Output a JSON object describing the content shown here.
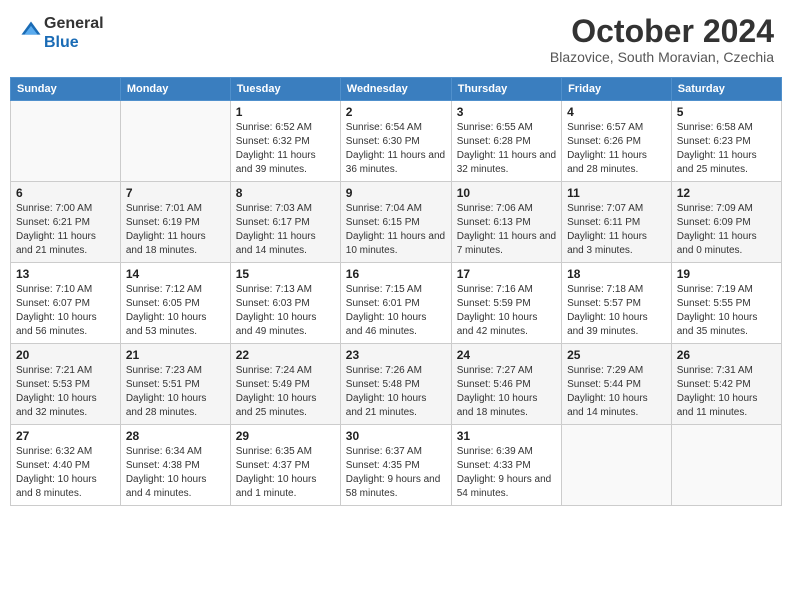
{
  "header": {
    "logo_line1": "General",
    "logo_line2": "Blue",
    "month": "October 2024",
    "location": "Blazovice, South Moravian, Czechia"
  },
  "weekdays": [
    "Sunday",
    "Monday",
    "Tuesday",
    "Wednesday",
    "Thursday",
    "Friday",
    "Saturday"
  ],
  "weeks": [
    [
      {
        "day": "",
        "sunrise": "",
        "sunset": "",
        "daylight": ""
      },
      {
        "day": "",
        "sunrise": "",
        "sunset": "",
        "daylight": ""
      },
      {
        "day": "1",
        "sunrise": "Sunrise: 6:52 AM",
        "sunset": "Sunset: 6:32 PM",
        "daylight": "Daylight: 11 hours and 39 minutes."
      },
      {
        "day": "2",
        "sunrise": "Sunrise: 6:54 AM",
        "sunset": "Sunset: 6:30 PM",
        "daylight": "Daylight: 11 hours and 36 minutes."
      },
      {
        "day": "3",
        "sunrise": "Sunrise: 6:55 AM",
        "sunset": "Sunset: 6:28 PM",
        "daylight": "Daylight: 11 hours and 32 minutes."
      },
      {
        "day": "4",
        "sunrise": "Sunrise: 6:57 AM",
        "sunset": "Sunset: 6:26 PM",
        "daylight": "Daylight: 11 hours and 28 minutes."
      },
      {
        "day": "5",
        "sunrise": "Sunrise: 6:58 AM",
        "sunset": "Sunset: 6:23 PM",
        "daylight": "Daylight: 11 hours and 25 minutes."
      }
    ],
    [
      {
        "day": "6",
        "sunrise": "Sunrise: 7:00 AM",
        "sunset": "Sunset: 6:21 PM",
        "daylight": "Daylight: 11 hours and 21 minutes."
      },
      {
        "day": "7",
        "sunrise": "Sunrise: 7:01 AM",
        "sunset": "Sunset: 6:19 PM",
        "daylight": "Daylight: 11 hours and 18 minutes."
      },
      {
        "day": "8",
        "sunrise": "Sunrise: 7:03 AM",
        "sunset": "Sunset: 6:17 PM",
        "daylight": "Daylight: 11 hours and 14 minutes."
      },
      {
        "day": "9",
        "sunrise": "Sunrise: 7:04 AM",
        "sunset": "Sunset: 6:15 PM",
        "daylight": "Daylight: 11 hours and 10 minutes."
      },
      {
        "day": "10",
        "sunrise": "Sunrise: 7:06 AM",
        "sunset": "Sunset: 6:13 PM",
        "daylight": "Daylight: 11 hours and 7 minutes."
      },
      {
        "day": "11",
        "sunrise": "Sunrise: 7:07 AM",
        "sunset": "Sunset: 6:11 PM",
        "daylight": "Daylight: 11 hours and 3 minutes."
      },
      {
        "day": "12",
        "sunrise": "Sunrise: 7:09 AM",
        "sunset": "Sunset: 6:09 PM",
        "daylight": "Daylight: 11 hours and 0 minutes."
      }
    ],
    [
      {
        "day": "13",
        "sunrise": "Sunrise: 7:10 AM",
        "sunset": "Sunset: 6:07 PM",
        "daylight": "Daylight: 10 hours and 56 minutes."
      },
      {
        "day": "14",
        "sunrise": "Sunrise: 7:12 AM",
        "sunset": "Sunset: 6:05 PM",
        "daylight": "Daylight: 10 hours and 53 minutes."
      },
      {
        "day": "15",
        "sunrise": "Sunrise: 7:13 AM",
        "sunset": "Sunset: 6:03 PM",
        "daylight": "Daylight: 10 hours and 49 minutes."
      },
      {
        "day": "16",
        "sunrise": "Sunrise: 7:15 AM",
        "sunset": "Sunset: 6:01 PM",
        "daylight": "Daylight: 10 hours and 46 minutes."
      },
      {
        "day": "17",
        "sunrise": "Sunrise: 7:16 AM",
        "sunset": "Sunset: 5:59 PM",
        "daylight": "Daylight: 10 hours and 42 minutes."
      },
      {
        "day": "18",
        "sunrise": "Sunrise: 7:18 AM",
        "sunset": "Sunset: 5:57 PM",
        "daylight": "Daylight: 10 hours and 39 minutes."
      },
      {
        "day": "19",
        "sunrise": "Sunrise: 7:19 AM",
        "sunset": "Sunset: 5:55 PM",
        "daylight": "Daylight: 10 hours and 35 minutes."
      }
    ],
    [
      {
        "day": "20",
        "sunrise": "Sunrise: 7:21 AM",
        "sunset": "Sunset: 5:53 PM",
        "daylight": "Daylight: 10 hours and 32 minutes."
      },
      {
        "day": "21",
        "sunrise": "Sunrise: 7:23 AM",
        "sunset": "Sunset: 5:51 PM",
        "daylight": "Daylight: 10 hours and 28 minutes."
      },
      {
        "day": "22",
        "sunrise": "Sunrise: 7:24 AM",
        "sunset": "Sunset: 5:49 PM",
        "daylight": "Daylight: 10 hours and 25 minutes."
      },
      {
        "day": "23",
        "sunrise": "Sunrise: 7:26 AM",
        "sunset": "Sunset: 5:48 PM",
        "daylight": "Daylight: 10 hours and 21 minutes."
      },
      {
        "day": "24",
        "sunrise": "Sunrise: 7:27 AM",
        "sunset": "Sunset: 5:46 PM",
        "daylight": "Daylight: 10 hours and 18 minutes."
      },
      {
        "day": "25",
        "sunrise": "Sunrise: 7:29 AM",
        "sunset": "Sunset: 5:44 PM",
        "daylight": "Daylight: 10 hours and 14 minutes."
      },
      {
        "day": "26",
        "sunrise": "Sunrise: 7:31 AM",
        "sunset": "Sunset: 5:42 PM",
        "daylight": "Daylight: 10 hours and 11 minutes."
      }
    ],
    [
      {
        "day": "27",
        "sunrise": "Sunrise: 6:32 AM",
        "sunset": "Sunset: 4:40 PM",
        "daylight": "Daylight: 10 hours and 8 minutes."
      },
      {
        "day": "28",
        "sunrise": "Sunrise: 6:34 AM",
        "sunset": "Sunset: 4:38 PM",
        "daylight": "Daylight: 10 hours and 4 minutes."
      },
      {
        "day": "29",
        "sunrise": "Sunrise: 6:35 AM",
        "sunset": "Sunset: 4:37 PM",
        "daylight": "Daylight: 10 hours and 1 minute."
      },
      {
        "day": "30",
        "sunrise": "Sunrise: 6:37 AM",
        "sunset": "Sunset: 4:35 PM",
        "daylight": "Daylight: 9 hours and 58 minutes."
      },
      {
        "day": "31",
        "sunrise": "Sunrise: 6:39 AM",
        "sunset": "Sunset: 4:33 PM",
        "daylight": "Daylight: 9 hours and 54 minutes."
      },
      {
        "day": "",
        "sunrise": "",
        "sunset": "",
        "daylight": ""
      },
      {
        "day": "",
        "sunrise": "",
        "sunset": "",
        "daylight": ""
      }
    ]
  ]
}
